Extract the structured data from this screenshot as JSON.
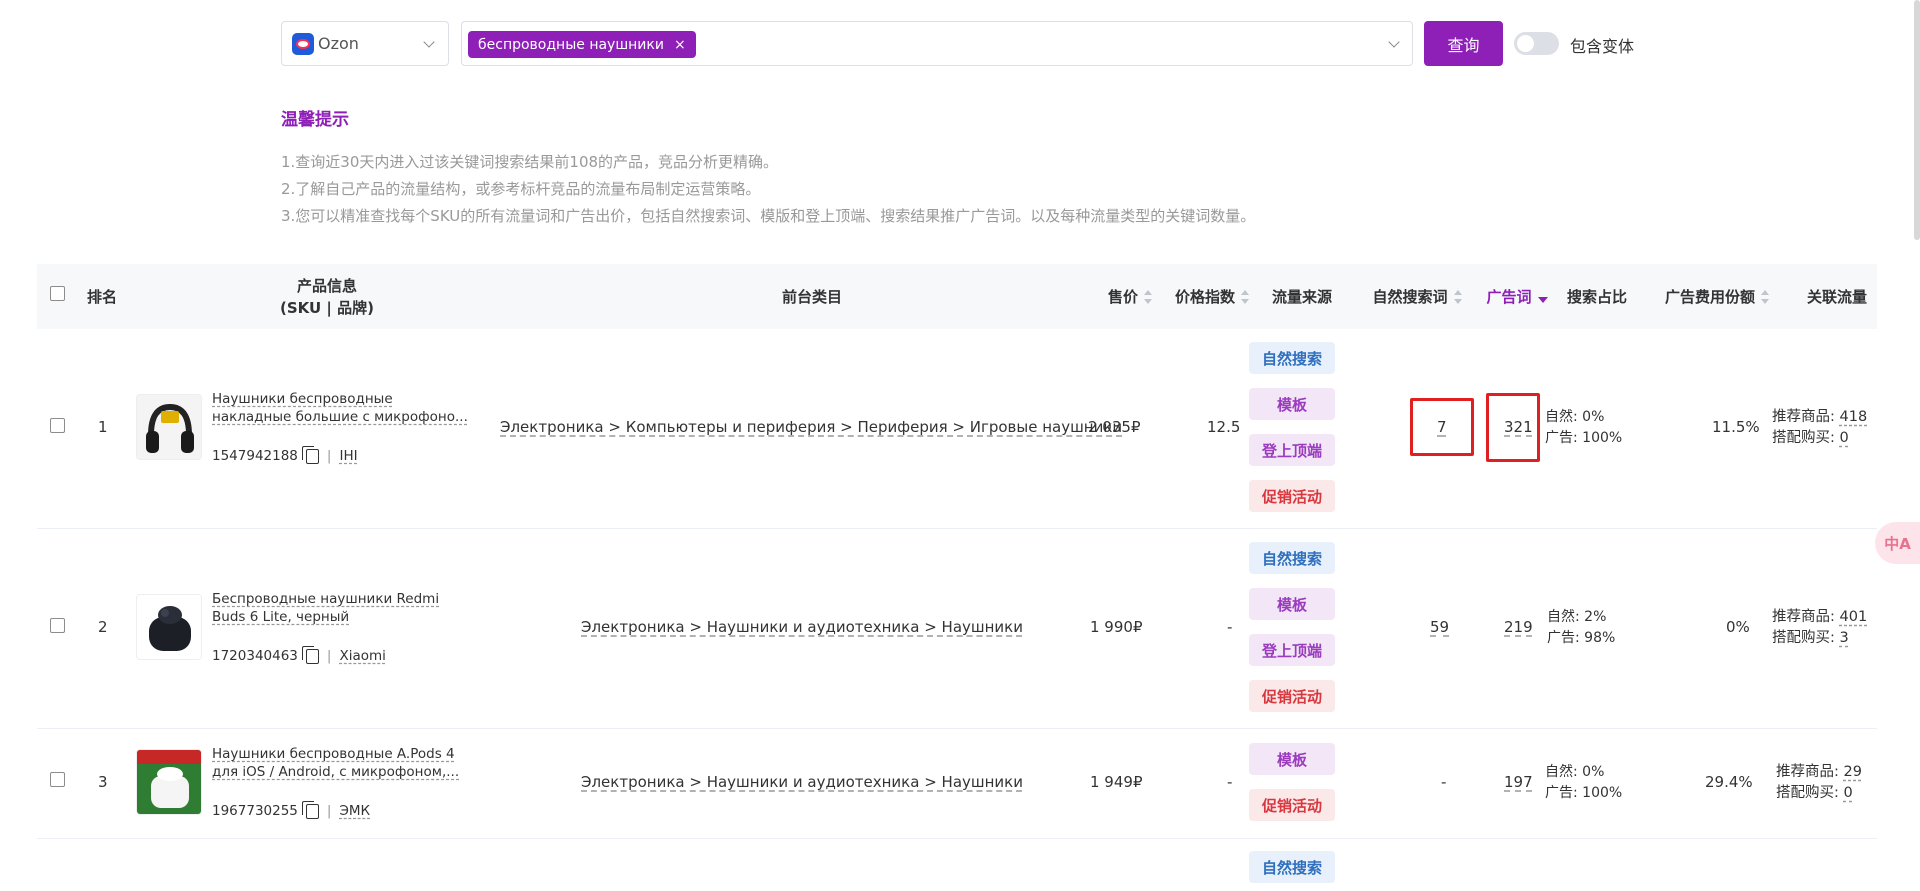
{
  "search": {
    "platform": "Ozon",
    "keyword_tag": "беспроводные наушники",
    "keyword_close": "×",
    "query_button": "查询",
    "include_variants": "包含变体"
  },
  "tips": {
    "title": "温馨提示",
    "lines": [
      "1.查询近30天内进入过该关键词搜索结果前108的产品，竞品分析更精确。",
      "2.了解自己产品的流量结构，或参考标杆竞品的流量布局制定运营策略。",
      "3.您可以精准查找每个SKU的所有流量词和广告出价，包括自然搜索词、模版和登上顶端、搜索结果推广广告词。以及每种流量类型的关键词数量。"
    ]
  },
  "table": {
    "headers": {
      "rank": "排名",
      "product_info_1": "产品信息",
      "product_info_2": "(SKU | 品牌)",
      "category": "前台类目",
      "price": "售价",
      "price_index": "价格指数",
      "traffic_source": "流量来源",
      "organic_keywords": "自然搜索词",
      "ad_keywords": "广告词",
      "search_share": "搜索占比",
      "ad_spend_share": "广告费用份额",
      "related_traffic": "关联流量"
    },
    "rows": [
      {
        "rank": "1",
        "title_line1": "Наушники беспроводные",
        "title_line2": "накладные большие с микрофоно...",
        "sku": "1547942188",
        "brand": "IHI",
        "category": "Электроника > Компьютеры и периферия > Периферия > Игровые наушники",
        "price": "2 035₽",
        "price_index": "12.5",
        "sources": [
          "自然搜索",
          "模板",
          "登上顶端",
          "促销活动"
        ],
        "organic": "7",
        "ads": "321",
        "natural_ratio": "自然: 0%",
        "ad_ratio": "广告: 100%",
        "ad_spend": "11.5%",
        "recommended_label": "推荐商品:",
        "recommended": "418",
        "bundle_label": "搭配购买:",
        "bundle": "0"
      },
      {
        "rank": "2",
        "title_line1": "Беспроводные наушники Redmi",
        "title_line2": "Buds 6 Lite, черный",
        "sku": "1720340463",
        "brand": "Xiaomi",
        "category": "Электроника > Наушники и аудиотехника > Наушники",
        "price": "1 990₽",
        "price_index": "-",
        "sources": [
          "自然搜索",
          "模板",
          "登上顶端",
          "促销活动"
        ],
        "organic": "59",
        "ads": "219",
        "natural_ratio": "自然: 2%",
        "ad_ratio": "广告: 98%",
        "ad_spend": "0%",
        "recommended_label": "推荐商品:",
        "recommended": "401",
        "bundle_label": "搭配购买:",
        "bundle": "3"
      },
      {
        "rank": "3",
        "title_line1": "Наушники беспроводные A.Pods 4",
        "title_line2": "для iOS / Android, с микрофоном,...",
        "sku": "1967730255",
        "brand": "ЭМК",
        "category": "Электроника > Наушники и аудиотехника > Наушники",
        "price": "1 949₽",
        "price_index": "-",
        "sources": [
          "模板",
          "促销活动"
        ],
        "organic": "-",
        "ads": "197",
        "natural_ratio": "自然: 0%",
        "ad_ratio": "广告: 100%",
        "ad_spend": "29.4%",
        "recommended_label": "推荐商品:",
        "recommended": "29",
        "bundle_label": "搭配购买:",
        "bundle": "0"
      },
      {
        "sources": [
          "自然搜索"
        ]
      }
    ]
  },
  "colors": {
    "accent": "#8e1fb7",
    "highlight": "#e02020",
    "badge_blue": "#2f6fbd",
    "badge_purple": "#9b3cbf",
    "badge_red": "#d9363e"
  },
  "icons": [
    "ozon-logo-icon",
    "chevron-down-icon",
    "close-icon",
    "copy-icon",
    "sort-icon",
    "translate-icon"
  ],
  "floating": {
    "translate_label": "中A"
  }
}
